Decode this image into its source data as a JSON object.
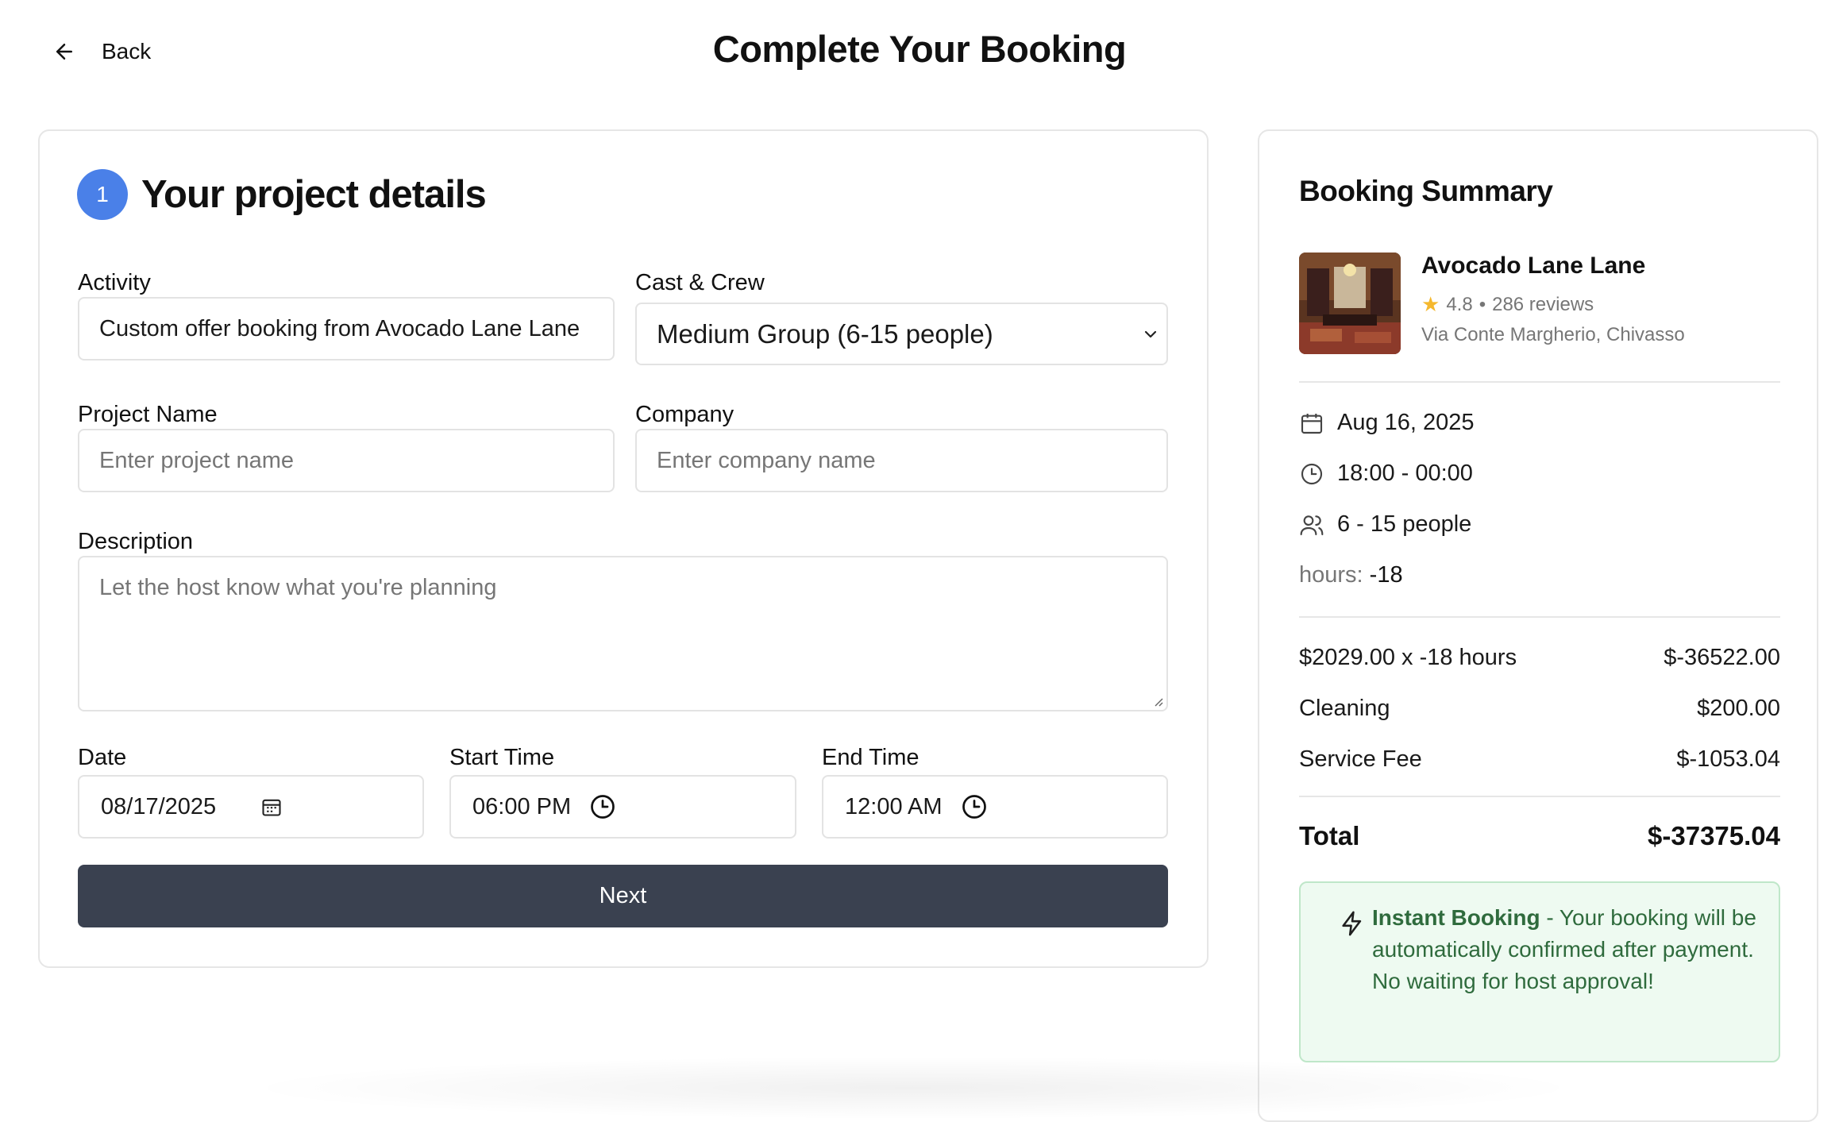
{
  "header": {
    "back_label": "Back",
    "title": "Complete Your Booking"
  },
  "form": {
    "step_number": "1",
    "section_title": "Your project details",
    "activity": {
      "label": "Activity",
      "value": "Custom offer booking from Avocado Lane Lane"
    },
    "cast_crew": {
      "label": "Cast & Crew",
      "value": "Medium Group (6-15 people)"
    },
    "project_name": {
      "label": "Project Name",
      "placeholder": "Enter project name"
    },
    "company": {
      "label": "Company",
      "placeholder": "Enter company name"
    },
    "description": {
      "label": "Description",
      "placeholder": "Let the host know what you're planning"
    },
    "date": {
      "label": "Date",
      "value": "08/17/2025"
    },
    "start_time": {
      "label": "Start Time",
      "value": "06:00 PM"
    },
    "end_time": {
      "label": "End Time",
      "value": "12:00 AM"
    },
    "next_label": "Next"
  },
  "summary": {
    "title": "Booking Summary",
    "venue": {
      "name": "Avocado Lane Lane",
      "rating": "4.8",
      "separator": "•",
      "reviews": "286 reviews",
      "address": "Via Conte Margherio, Chivasso"
    },
    "date": "Aug 16, 2025",
    "time": "18:00 - 00:00",
    "people": "6 - 15 people",
    "hours_label": "hours:",
    "hours_value": "-18",
    "lines": [
      {
        "label": "$2029.00 x -18 hours",
        "amount": "$-36522.00"
      },
      {
        "label": "Cleaning",
        "amount": "$200.00"
      },
      {
        "label": "Service Fee",
        "amount": "$-1053.04"
      }
    ],
    "total_label": "Total",
    "total_amount": "$-37375.04",
    "instant": {
      "title": "Instant Booking",
      "text": " - Your booking will be automatically confirmed after payment. No waiting for host approval!"
    }
  },
  "colors": {
    "accent": "#4a80e8",
    "button": "#3a4150",
    "success_bg": "#eefaf1",
    "success_text": "#2f6b3d",
    "star": "#f5b82e"
  }
}
